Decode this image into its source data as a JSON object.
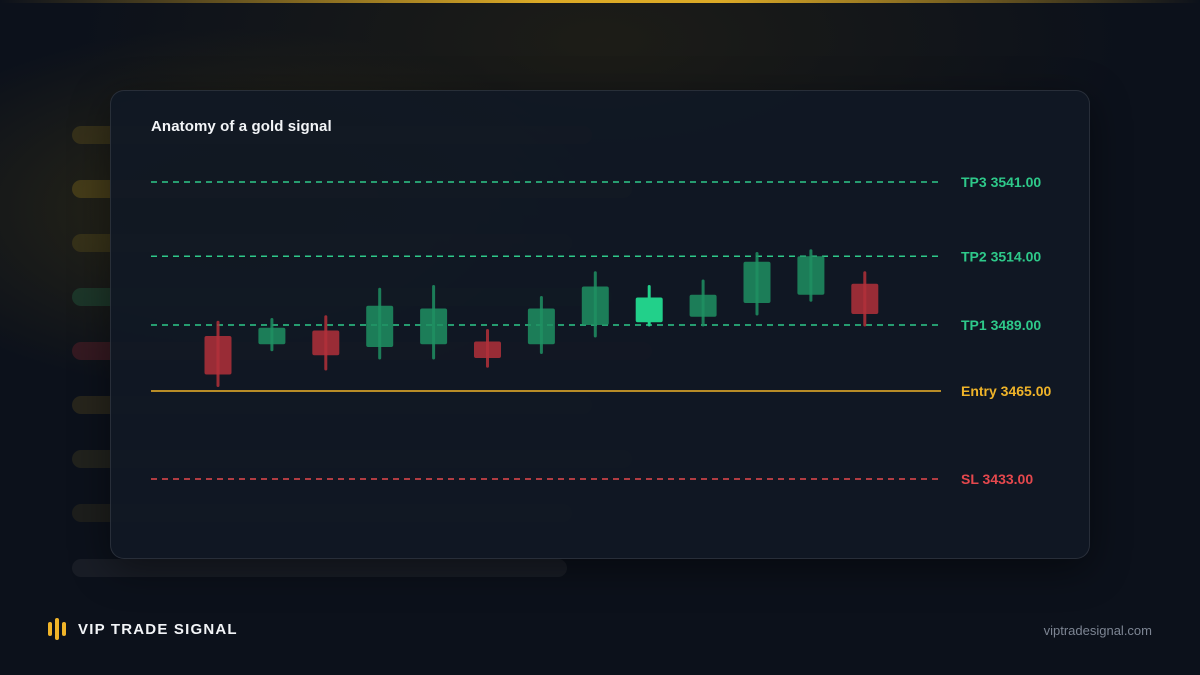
{
  "brand": {
    "name": "VIP TRADE SIGNAL",
    "url": "viptradesignal.com",
    "accent": "#f0b429"
  },
  "colors": {
    "bullish": "#1f8f62",
    "bullish_highlight": "#22d08a",
    "bearish": "#b23039",
    "tp_line": "#2ec98a",
    "entry_line": "#f0b429",
    "sl_line": "#e5484d"
  },
  "chart_data": {
    "type": "candlestick",
    "title": "Anatomy of a gold signal",
    "ylim": [
      3420,
      3555
    ],
    "levels": [
      {
        "key": "tp3",
        "label": "TP3 3541.00",
        "price": 3541.0,
        "style": "dashed",
        "color": "#2ec98a"
      },
      {
        "key": "tp2",
        "label": "TP2 3514.00",
        "price": 3514.0,
        "style": "dashed",
        "color": "#2ec98a"
      },
      {
        "key": "tp1",
        "label": "TP1 3489.00",
        "price": 3489.0,
        "style": "dashed",
        "color": "#2ec98a"
      },
      {
        "key": "entry",
        "label": "Entry 3465.00",
        "price": 3465.0,
        "style": "solid",
        "color": "#f0b429"
      },
      {
        "key": "sl",
        "label": "SL 3433.00",
        "price": 3433.0,
        "style": "dashed",
        "color": "#e5484d"
      }
    ],
    "candles": [
      {
        "open": 3485,
        "close": 3471,
        "high": 3490,
        "low": 3467,
        "highlight": false
      },
      {
        "open": 3482,
        "close": 3488,
        "high": 3491,
        "low": 3480,
        "highlight": false
      },
      {
        "open": 3487,
        "close": 3478,
        "high": 3492,
        "low": 3473,
        "highlight": false
      },
      {
        "open": 3481,
        "close": 3496,
        "high": 3502,
        "low": 3477,
        "highlight": false
      },
      {
        "open": 3482,
        "close": 3495,
        "high": 3503,
        "low": 3477,
        "highlight": false
      },
      {
        "open": 3483,
        "close": 3477,
        "high": 3487,
        "low": 3474,
        "highlight": false
      },
      {
        "open": 3482,
        "close": 3495,
        "high": 3499,
        "low": 3479,
        "highlight": false
      },
      {
        "open": 3489,
        "close": 3503,
        "high": 3508,
        "low": 3485,
        "highlight": false
      },
      {
        "open": 3490,
        "close": 3499,
        "high": 3503,
        "low": 3489,
        "highlight": true
      },
      {
        "open": 3492,
        "close": 3500,
        "high": 3505,
        "low": 3489,
        "highlight": false
      },
      {
        "open": 3497,
        "close": 3512,
        "high": 3515,
        "low": 3493,
        "highlight": false
      },
      {
        "open": 3500,
        "close": 3514,
        "high": 3516,
        "low": 3498,
        "highlight": false
      },
      {
        "open": 3504,
        "close": 3493,
        "high": 3508,
        "low": 3489,
        "highlight": false
      }
    ]
  }
}
